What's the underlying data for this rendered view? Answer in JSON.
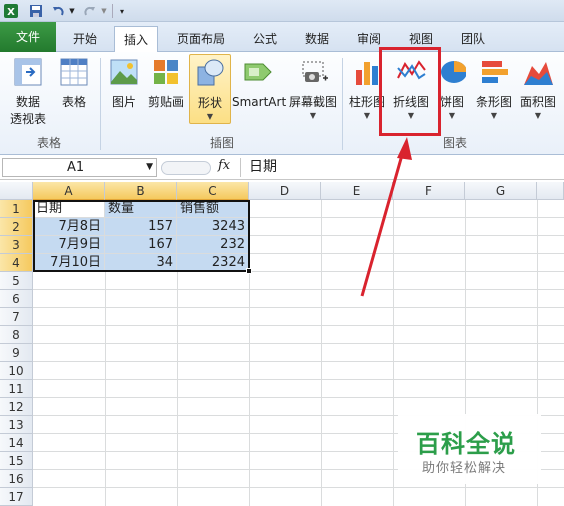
{
  "tabs": [
    "文件",
    "开始",
    "插入",
    "页面布局",
    "公式",
    "数据",
    "审阅",
    "视图",
    "团队"
  ],
  "ribbon": {
    "pivot_label_1": "数据",
    "pivot_label_2": "透视表",
    "table_label": "表格",
    "picture_label": "图片",
    "clipart_label": "剪贴画",
    "shapes_label": "形状",
    "smartart_label": "SmartArt",
    "screenshot_label": "屏幕截图",
    "column_chart_label": "柱形图",
    "line_chart_label": "折线图",
    "pie_chart_label": "饼图",
    "bar_chart_label": "条形图",
    "area_chart_label": "面积图",
    "group_tables": "表格",
    "group_illustrations": "插图",
    "group_charts": "图表"
  },
  "formula_bar": {
    "name_box": "A1",
    "fx": "fx",
    "value": "日期"
  },
  "columns": [
    "A",
    "B",
    "C",
    "D",
    "E",
    "F",
    "G"
  ],
  "rows": [
    "1",
    "2",
    "3",
    "4",
    "5",
    "6",
    "7",
    "8",
    "9",
    "10",
    "11",
    "12",
    "13",
    "14",
    "15",
    "16",
    "17"
  ],
  "table": {
    "header": [
      "日期",
      "数量",
      "销售额"
    ],
    "rows": [
      [
        "7月8日",
        "157",
        "3243"
      ],
      [
        "7月9日",
        "167",
        "232"
      ],
      [
        "7月10日",
        "34",
        "2324"
      ]
    ]
  },
  "watermark": {
    "title": "百科全说",
    "subtitle": "助你轻松解决"
  },
  "colors": {
    "file_tab": "#2c8a39",
    "highlight": "#d9232e",
    "selection": "#c5daf1",
    "watermark": "#2c9e4a"
  }
}
